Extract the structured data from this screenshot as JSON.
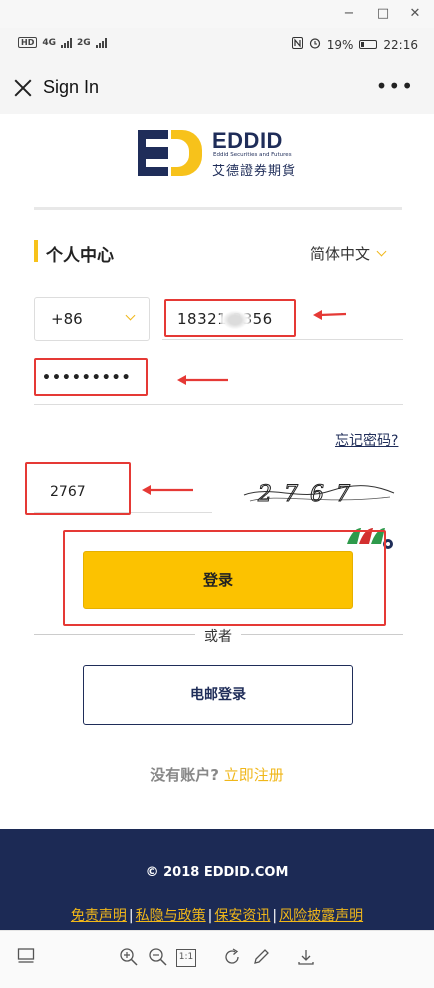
{
  "window": {
    "minimize_glyph": "−",
    "maximize_glyph": "□",
    "close_glyph": "✕"
  },
  "status_bar": {
    "hd_label": "HD",
    "net1": "4G",
    "net2": "2G",
    "battery_pct": "19%",
    "time": "22:16",
    "icons": [
      "nfc-icon",
      "alarm-icon",
      "battery-icon"
    ]
  },
  "header": {
    "title": "Sign In",
    "more_glyph": "•••"
  },
  "logo": {
    "name": "EDDID",
    "subtitle": "Eddid Securities and Futures",
    "chinese": "艾德證券期貨"
  },
  "section": {
    "title": "个人中心",
    "language": "简体中文"
  },
  "form": {
    "country_code": "+86",
    "phone": "18321  3356",
    "password": "•••••••••",
    "forgot_password": "忘记密码?",
    "captcha_input": "2767",
    "captcha_image_text": "2767",
    "login_button": "登录",
    "or_text": "或者",
    "email_login_button": "电邮登录",
    "no_account_text": "没有账户?",
    "register_link": "立即注册"
  },
  "footer": {
    "copyright": "© 2018 EDDID.COM",
    "links": [
      "免责声明",
      "私隐与政策",
      "保安资讯",
      "风险披露声明"
    ],
    "separator": "|"
  },
  "toolbar": {
    "icons": [
      "layout-icon",
      "zoom-in-icon",
      "zoom-out-icon",
      "actual-size-icon",
      "rotate-icon",
      "edit-icon",
      "download-icon"
    ],
    "actual_size_label": "1:1"
  },
  "colors": {
    "brand_navy": "#1f2d59",
    "brand_yellow": "#fcc200",
    "annotation_red": "#e53935"
  }
}
